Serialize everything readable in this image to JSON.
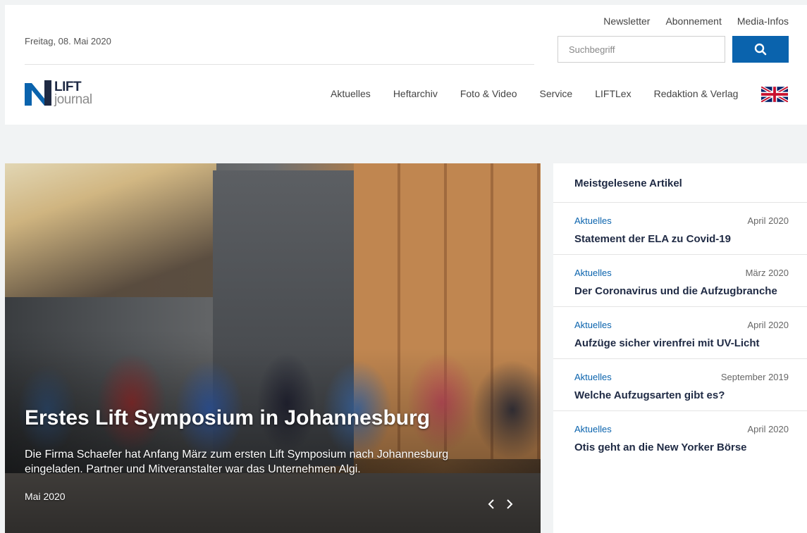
{
  "header": {
    "date": "Freitag, 08. Mai 2020",
    "top_links": [
      "Newsletter",
      "Abonnement",
      "Media-Infos"
    ],
    "search_placeholder": "Suchbegriff",
    "logo_line1": "LIFT",
    "logo_line2": "journal",
    "nav": [
      "Aktuelles",
      "Heftarchiv",
      "Foto & Video",
      "Service",
      "LIFTLex",
      "Redaktion & Verlag"
    ],
    "accent_color": "#0a63ad"
  },
  "hero": {
    "title": "Erstes Lift Symposium in Johannesburg",
    "text": "Die Firma Schaefer hat Anfang März zum ersten Lift Symposium nach Johannesburg eingeladen. Partner und Mitveranstalter war das Unternehmen Algi.",
    "date": "Mai 2020"
  },
  "sidebar": {
    "title": "Meistgelesene Artikel",
    "articles": [
      {
        "category": "Aktuelles",
        "date": "April 2020",
        "title": "Statement der ELA zu Covid-19"
      },
      {
        "category": "Aktuelles",
        "date": "März 2020",
        "title": "Der Coronavirus und die Aufzugbranche"
      },
      {
        "category": "Aktuelles",
        "date": "April 2020",
        "title": "Aufzüge sicher virenfrei mit UV-Licht"
      },
      {
        "category": "Aktuelles",
        "date": "September 2019",
        "title": "Welche Aufzugsarten gibt es?"
      },
      {
        "category": "Aktuelles",
        "date": "April 2020",
        "title": "Otis geht an die New Yorker Börse"
      }
    ]
  }
}
